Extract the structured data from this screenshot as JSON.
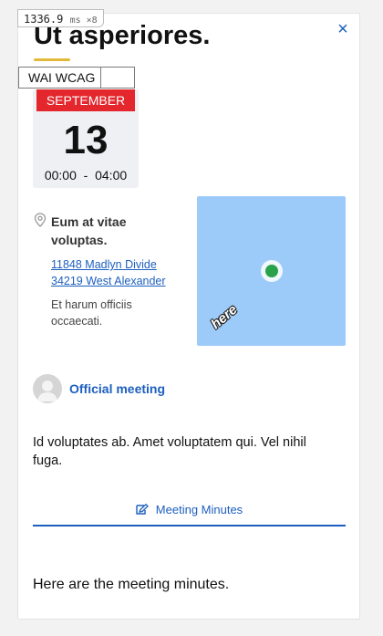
{
  "dialog": {
    "title": "Ut asperiores.",
    "close_label": "×"
  },
  "perf_badge": {
    "value": "1336.9",
    "unit": "ms ×8"
  },
  "wcag_badge": {
    "label": "WAI WCAG"
  },
  "date": {
    "month": "SEPTEMBER",
    "day": "13",
    "start_time": "00:00",
    "separator": "-",
    "end_time": "04:00"
  },
  "location": {
    "name": "Eum at vitae voluptas.",
    "address_line1": "11848 Madlyn Divide",
    "address_line2": "34219 West Alexander",
    "note": "Et harum officiis occaecati.",
    "map_logo": "here"
  },
  "organizer": {
    "label": "Official meeting"
  },
  "description": "Id voluptates ab. Amet voluptatem qui. Vel nihil fuga.",
  "tabs": [
    {
      "label": "Meeting Minutes",
      "icon": "edit-note-icon",
      "active": true
    }
  ],
  "minutes_text": "Here are the meeting minutes.",
  "colors": {
    "accent": "#1d5fbf",
    "month_banner": "#e4262d",
    "title_underline": "#e2b93b",
    "map_water": "#9dcbf9",
    "map_marker": "#2aa24a"
  }
}
